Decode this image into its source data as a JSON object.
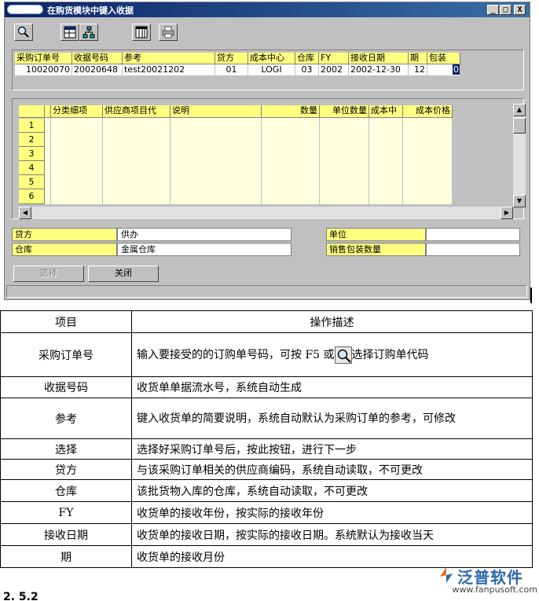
{
  "window": {
    "title": "在购货模块中键入收据",
    "controls": [
      "_",
      "□",
      "X"
    ]
  },
  "toolbar": {
    "icons": [
      "search-icon",
      "grid-icon",
      "tree-icon",
      "columns-icon",
      "print-icon"
    ]
  },
  "header_grid": {
    "columns": [
      "采购订单号",
      "收据号码",
      "参考",
      "贷方",
      "成本中心",
      "仓库",
      "FY",
      "接收日期",
      "期",
      "包装"
    ],
    "values": [
      "10020070",
      "20020648",
      "test20021202",
      "01",
      "LOGI",
      "03",
      "2002",
      "2002-12-30",
      "12",
      "0"
    ]
  },
  "detail_grid": {
    "columns": [
      "分类细项",
      "供应商项目代",
      "说明",
      "数量",
      "单位数量",
      "成本中",
      "成本价格"
    ],
    "row_numbers": [
      "1",
      "2",
      "3",
      "4",
      "5",
      "6"
    ]
  },
  "info": {
    "supplier_label": "贷方",
    "supplier_value": "供办",
    "warehouse_label": "仓库",
    "warehouse_value": "金属仓库",
    "unit_label": "单位",
    "unit_value": "",
    "pack_qty_label": "销售包装数量",
    "pack_qty_value": ""
  },
  "buttons": {
    "select": "选择",
    "close": "关闭"
  },
  "description_table": {
    "header": [
      "项目",
      "操作描述"
    ],
    "rows": [
      {
        "item": "采购订单号",
        "desc_before": "输入要接受的的订购单号码，可按 F5 或",
        "desc_after": "选择订购单代码"
      },
      {
        "item": "收据号码",
        "desc": "收货单单据流水号，系统自动生成"
      },
      {
        "item": "参考",
        "desc": "键入收货单的简要说明，系统自动默认为采购订单的参考，可修改"
      },
      {
        "item": "选择",
        "desc": "选择好采购订单号后，按此按钮，进行下一步"
      },
      {
        "item": "贷方",
        "desc": "与该采购订单相关的供应商编码，系统自动读取，不可更改"
      },
      {
        "item": "仓库",
        "desc": "该批货物入库的仓库，系统自动读取，不可更改"
      },
      {
        "item": "FY",
        "desc": "收货单的接收年份，按实际的接收年份"
      },
      {
        "item": "接收日期",
        "desc": "收货单的接收日期，按实际的接收日期。系统默认为接收当天"
      },
      {
        "item": "期",
        "desc": "收货单的接收月份"
      }
    ]
  },
  "watermark": {
    "brand": "泛普软件",
    "url": "www.fanpusoft.com"
  },
  "page_number_fragment": "2. 5.2"
}
